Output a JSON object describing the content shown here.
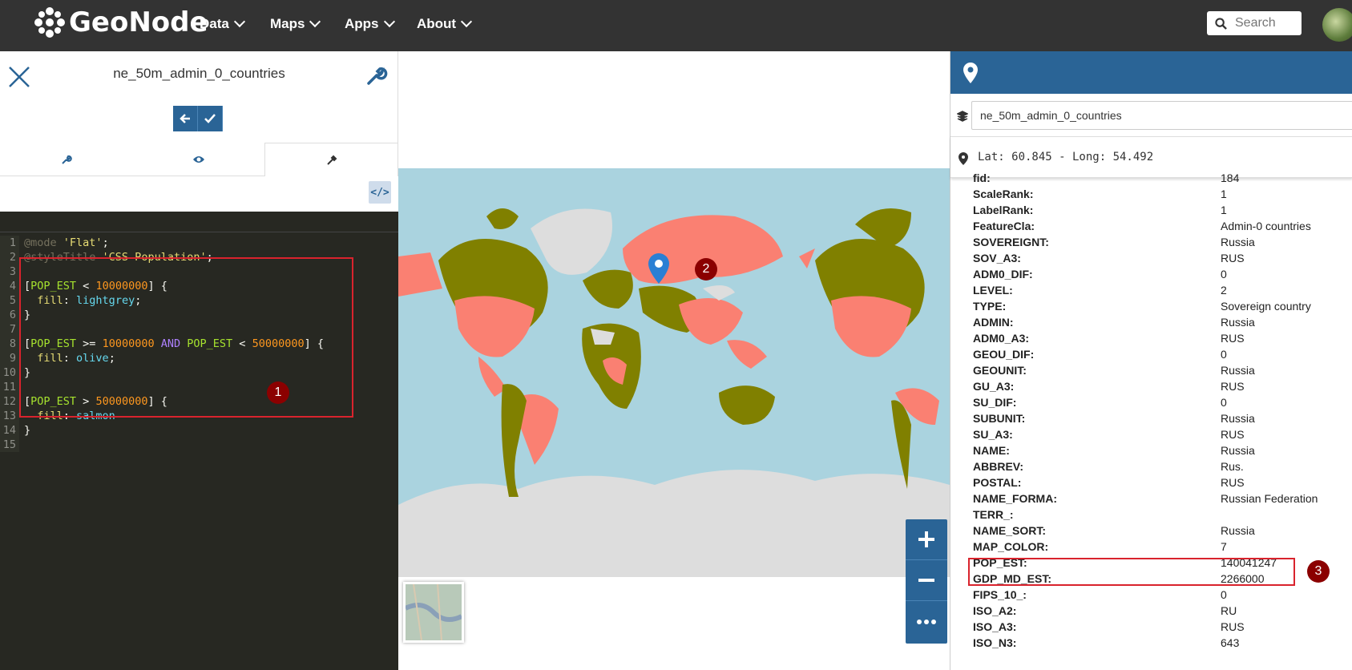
{
  "topbar": {
    "brand": "GeoNode",
    "nav": [
      {
        "label": "Data"
      },
      {
        "label": "Maps"
      },
      {
        "label": "Apps"
      },
      {
        "label": "About"
      }
    ],
    "search_placeholder": "Search"
  },
  "style_editor": {
    "layer_title": "ne_50m_admin_0_countries",
    "code_lines": [
      "@mode 'Flat';",
      "@styleTitle 'CSS Population';",
      "",
      "[POP_EST < 10000000] {",
      "  fill: lightgrey;",
      "}",
      "",
      "[POP_EST >= 10000000 AND POP_EST < 50000000] {",
      "  fill: olive;",
      "}",
      "",
      "[POP_EST > 50000000] {",
      "  fill: salmon",
      "}",
      ""
    ]
  },
  "identify": {
    "layer": "ne_50m_admin_0_countries",
    "coords": "Lat: 60.845 - Long: 54.492",
    "properties": [
      {
        "k": "fid:",
        "v": "184"
      },
      {
        "k": "ScaleRank:",
        "v": "1"
      },
      {
        "k": "LabelRank:",
        "v": "1"
      },
      {
        "k": "FeatureCla:",
        "v": "Admin-0 countries"
      },
      {
        "k": "SOVEREIGNT:",
        "v": "Russia"
      },
      {
        "k": "SOV_A3:",
        "v": "RUS"
      },
      {
        "k": "ADM0_DIF:",
        "v": "0"
      },
      {
        "k": "LEVEL:",
        "v": "2"
      },
      {
        "k": "TYPE:",
        "v": "Sovereign country"
      },
      {
        "k": "ADMIN:",
        "v": "Russia"
      },
      {
        "k": "ADM0_A3:",
        "v": "RUS"
      },
      {
        "k": "GEOU_DIF:",
        "v": "0"
      },
      {
        "k": "GEOUNIT:",
        "v": "Russia"
      },
      {
        "k": "GU_A3:",
        "v": "RUS"
      },
      {
        "k": "SU_DIF:",
        "v": "0"
      },
      {
        "k": "SUBUNIT:",
        "v": "Russia"
      },
      {
        "k": "SU_A3:",
        "v": "RUS"
      },
      {
        "k": "NAME:",
        "v": "Russia"
      },
      {
        "k": "ABBREV:",
        "v": "Rus."
      },
      {
        "k": "POSTAL:",
        "v": "RUS"
      },
      {
        "k": "NAME_FORMA:",
        "v": "Russian Federation"
      },
      {
        "k": "TERR_:",
        "v": ""
      },
      {
        "k": "NAME_SORT:",
        "v": "Russia"
      },
      {
        "k": "MAP_COLOR:",
        "v": "7"
      },
      {
        "k": "POP_EST:",
        "v": "140041247"
      },
      {
        "k": "GDP_MD_EST:",
        "v": "2266000"
      },
      {
        "k": "FIPS_10_:",
        "v": "0"
      },
      {
        "k": "ISO_A2:",
        "v": "RU"
      },
      {
        "k": "ISO_A3:",
        "v": "RUS"
      },
      {
        "k": "ISO_N3:",
        "v": "643"
      }
    ]
  },
  "callouts": [
    "1",
    "2",
    "3"
  ],
  "colors": {
    "accent": "#2a6496",
    "topbar": "#333333",
    "sea": "#aad3df",
    "olive": "#808000",
    "salmon": "#fa8072",
    "lightgrey": "#d3d3d3"
  }
}
